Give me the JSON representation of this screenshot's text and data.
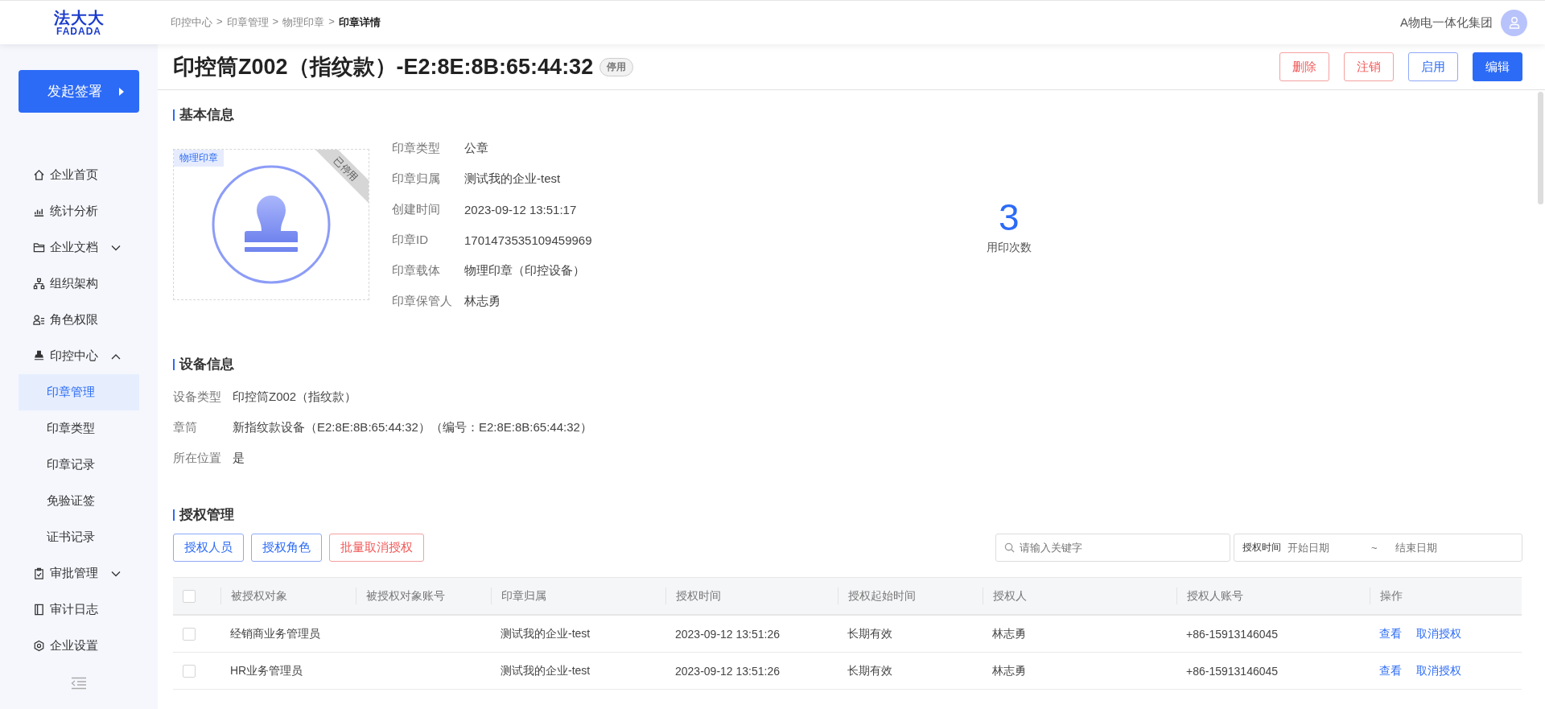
{
  "logo": {
    "title": "法大大",
    "subtitle": "FADADA"
  },
  "breadcrumb_separator": ">",
  "breadcrumb": [
    {
      "label": "印控中心",
      "current": false
    },
    {
      "label": "印章管理",
      "current": false
    },
    {
      "label": "物理印章",
      "current": false
    },
    {
      "label": "印章详情",
      "current": true
    }
  ],
  "user": {
    "name": "A物电一体化集团"
  },
  "sidebar": {
    "primary_button": "发起签署",
    "items": [
      {
        "label": "企业首页",
        "selected": false
      },
      {
        "label": "统计分析",
        "selected": false
      },
      {
        "label": "企业文档",
        "selected": false,
        "expanded": false
      },
      {
        "label": "组织架构",
        "selected": false
      },
      {
        "label": "角色权限",
        "selected": false
      },
      {
        "label": "印控中心",
        "selected": false,
        "expanded": true,
        "children": [
          {
            "label": "印章管理",
            "selected": true
          },
          {
            "label": "印章类型",
            "selected": false
          },
          {
            "label": "印章记录",
            "selected": false
          },
          {
            "label": "免验证签",
            "selected": false
          },
          {
            "label": "证书记录",
            "selected": false
          }
        ]
      },
      {
        "label": "审批管理",
        "selected": false,
        "expanded": false
      },
      {
        "label": "审计日志",
        "selected": false
      },
      {
        "label": "企业设置",
        "selected": false
      }
    ]
  },
  "page_title": {
    "text": "印控筒Z002（指纹款）-E2:8E:8B:65:44:32",
    "status": "停用"
  },
  "actions": [
    {
      "label": "删除",
      "kind": "danger"
    },
    {
      "label": "注销",
      "kind": "danger"
    },
    {
      "label": "启用",
      "kind": "outline"
    },
    {
      "label": "编辑",
      "kind": "primary"
    }
  ],
  "basic_info": {
    "title": "基本信息",
    "seal": {
      "tag": "物理印章",
      "ribbon": "已停用"
    },
    "fields": [
      {
        "label": "印章类型",
        "value": "公章"
      },
      {
        "label": "印章归属",
        "value": "测试我的企业-test"
      },
      {
        "label": "创建时间",
        "value": "2023-09-12 13:51:17"
      },
      {
        "label": "印章ID",
        "value": "1701473535109459969"
      },
      {
        "label": "印章载体",
        "value": "物理印章（印控设备）"
      },
      {
        "label": "印章保管人",
        "value": "林志勇"
      }
    ],
    "usage": {
      "count": "3",
      "label": "用印次数"
    }
  },
  "device_info": {
    "title": "设备信息",
    "fields": [
      {
        "label": "设备类型",
        "value": "印控筒Z002（指纹款）"
      },
      {
        "label": "章筒",
        "value": "新指纹款设备（E2:8E:8B:65:44:32）（编号：E2:8E:8B:65:44:32）"
      },
      {
        "label": "所在位置",
        "value": "是"
      }
    ]
  },
  "authorization": {
    "title": "授权管理",
    "buttons": [
      {
        "label": "授权人员",
        "kind": "outline"
      },
      {
        "label": "授权角色",
        "kind": "outline"
      },
      {
        "label": "批量取消授权",
        "kind": "danger"
      }
    ],
    "search": {
      "placeholder": "请输入关键字"
    },
    "date_range": {
      "label": "授权时间",
      "start_placeholder": "开始日期",
      "separator": "~",
      "end_placeholder": "结束日期"
    },
    "table": {
      "all_selected": false,
      "columns": [
        "被授权对象",
        "被授权对象账号",
        "印章归属",
        "授权时间",
        "授权起始时间",
        "授权人",
        "授权人账号",
        "操作"
      ],
      "rows": [
        {
          "selected": false,
          "cells": [
            "经销商业务管理员",
            "",
            "测试我的企业-test",
            "2023-09-12 13:51:26",
            "长期有效",
            "林志勇",
            "+86-15913146045"
          ],
          "actions": [
            "查看",
            "取消授权"
          ]
        },
        {
          "selected": false,
          "cells": [
            "HR业务管理员",
            "",
            "测试我的企业-test",
            "2023-09-12 13:51:26",
            "长期有效",
            "林志勇",
            "+86-15913146045"
          ],
          "actions": [
            "查看",
            "取消授权"
          ]
        }
      ]
    }
  }
}
